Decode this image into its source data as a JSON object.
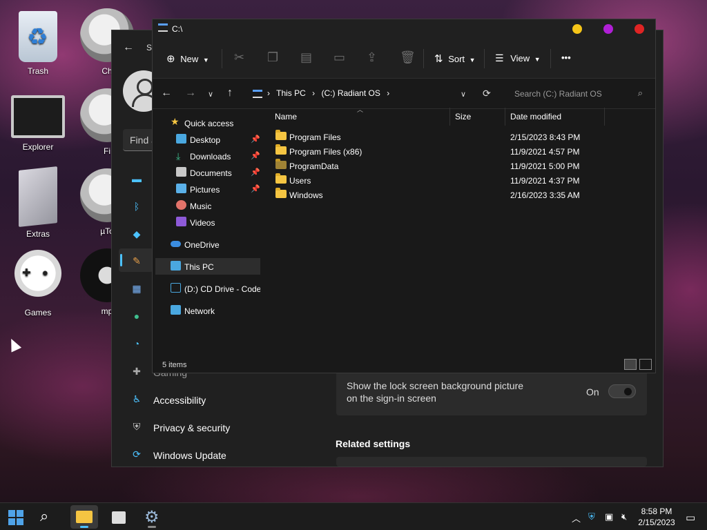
{
  "desktop": {
    "icons": [
      {
        "label": "Trash"
      },
      {
        "label": "Explorer"
      },
      {
        "label": "Extras"
      },
      {
        "label": "Games"
      },
      {
        "label": "Ch"
      },
      {
        "label": "Fi"
      },
      {
        "label": "µTo"
      },
      {
        "label": "mp"
      }
    ]
  },
  "settings": {
    "title_partial": "Se",
    "search_placeholder": "Find a",
    "nav": [
      {
        "label": "Gaming",
        "icon": "gamepad-icon"
      },
      {
        "label": "Accessibility",
        "icon": "accessibility-icon"
      },
      {
        "label": "Privacy & security",
        "icon": "shield-icon"
      },
      {
        "label": "Windows Update",
        "icon": "refresh-icon"
      }
    ],
    "lock_screen_setting": "Show the lock screen background picture on the sign-in screen",
    "toggle_state": "On",
    "related_settings": "Related settings"
  },
  "explorer": {
    "title": "C:\\",
    "window_buttons": {
      "minimize": "#f5c518",
      "maximize": "#b01fd6",
      "close": "#e02424"
    },
    "toolbar": {
      "new": "New",
      "sort": "Sort",
      "view": "View",
      "more": "•••"
    },
    "breadcrumb": [
      "This PC",
      "(C:) Radiant OS"
    ],
    "search_placeholder": "Search (C:) Radiant OS",
    "sidebar": {
      "quick_access": "Quick access",
      "pinned": [
        {
          "label": "Desktop",
          "pinned": true
        },
        {
          "label": "Downloads",
          "pinned": true
        },
        {
          "label": "Documents",
          "pinned": true
        },
        {
          "label": "Pictures",
          "pinned": true
        },
        {
          "label": "Music",
          "pinned": false
        },
        {
          "label": "Videos",
          "pinned": false
        }
      ],
      "onedrive": "OneDrive",
      "this_pc": "This PC",
      "cd_drive": "(D:) CD Drive - Code",
      "network": "Network"
    },
    "columns": {
      "name": "Name",
      "size": "Size",
      "date": "Date modified"
    },
    "files": [
      {
        "name": "Program Files",
        "date": "2/15/2023 8:43 PM"
      },
      {
        "name": "Program Files (x86)",
        "date": "11/9/2021 4:57 PM"
      },
      {
        "name": "ProgramData",
        "date": "11/9/2021 5:00 PM"
      },
      {
        "name": "Users",
        "date": "11/9/2021 4:37 PM"
      },
      {
        "name": "Windows",
        "date": "2/16/2023 3:35 AM"
      }
    ],
    "status": "5 items"
  },
  "taskbar": {
    "time": "8:58 PM",
    "date": "2/15/2023"
  }
}
